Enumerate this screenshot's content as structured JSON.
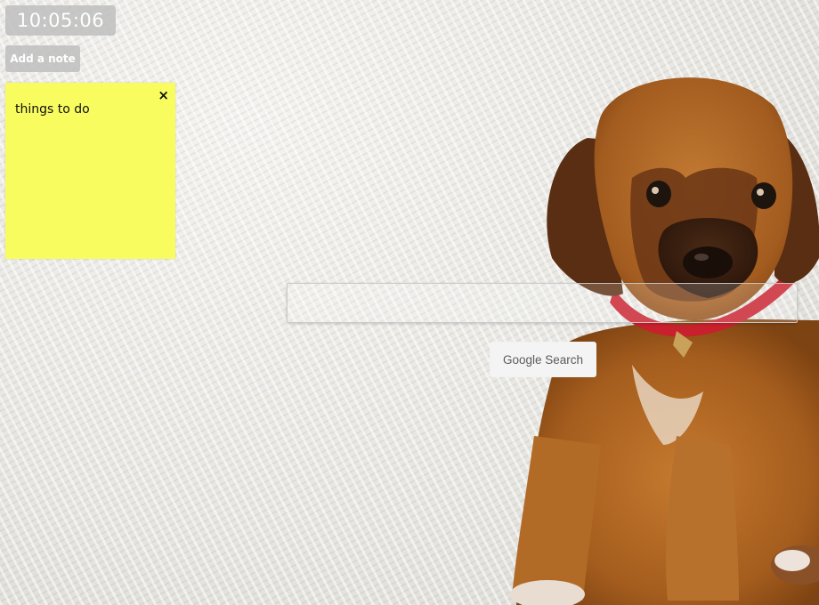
{
  "clock": {
    "time": "10:05:06"
  },
  "notes": {
    "add_button_label": "Add a note +",
    "items": [
      {
        "text": "things to do",
        "close_label": "×",
        "color": "#f9fc5f"
      }
    ]
  },
  "search": {
    "placeholder": "",
    "value": "",
    "button_label": "Google Search"
  },
  "background": {
    "subject": "puppy on knitted carpet",
    "carpet_color": "#ecebe7",
    "puppy_fur_color": "#b06a25",
    "collar_color": "#c8202c"
  }
}
